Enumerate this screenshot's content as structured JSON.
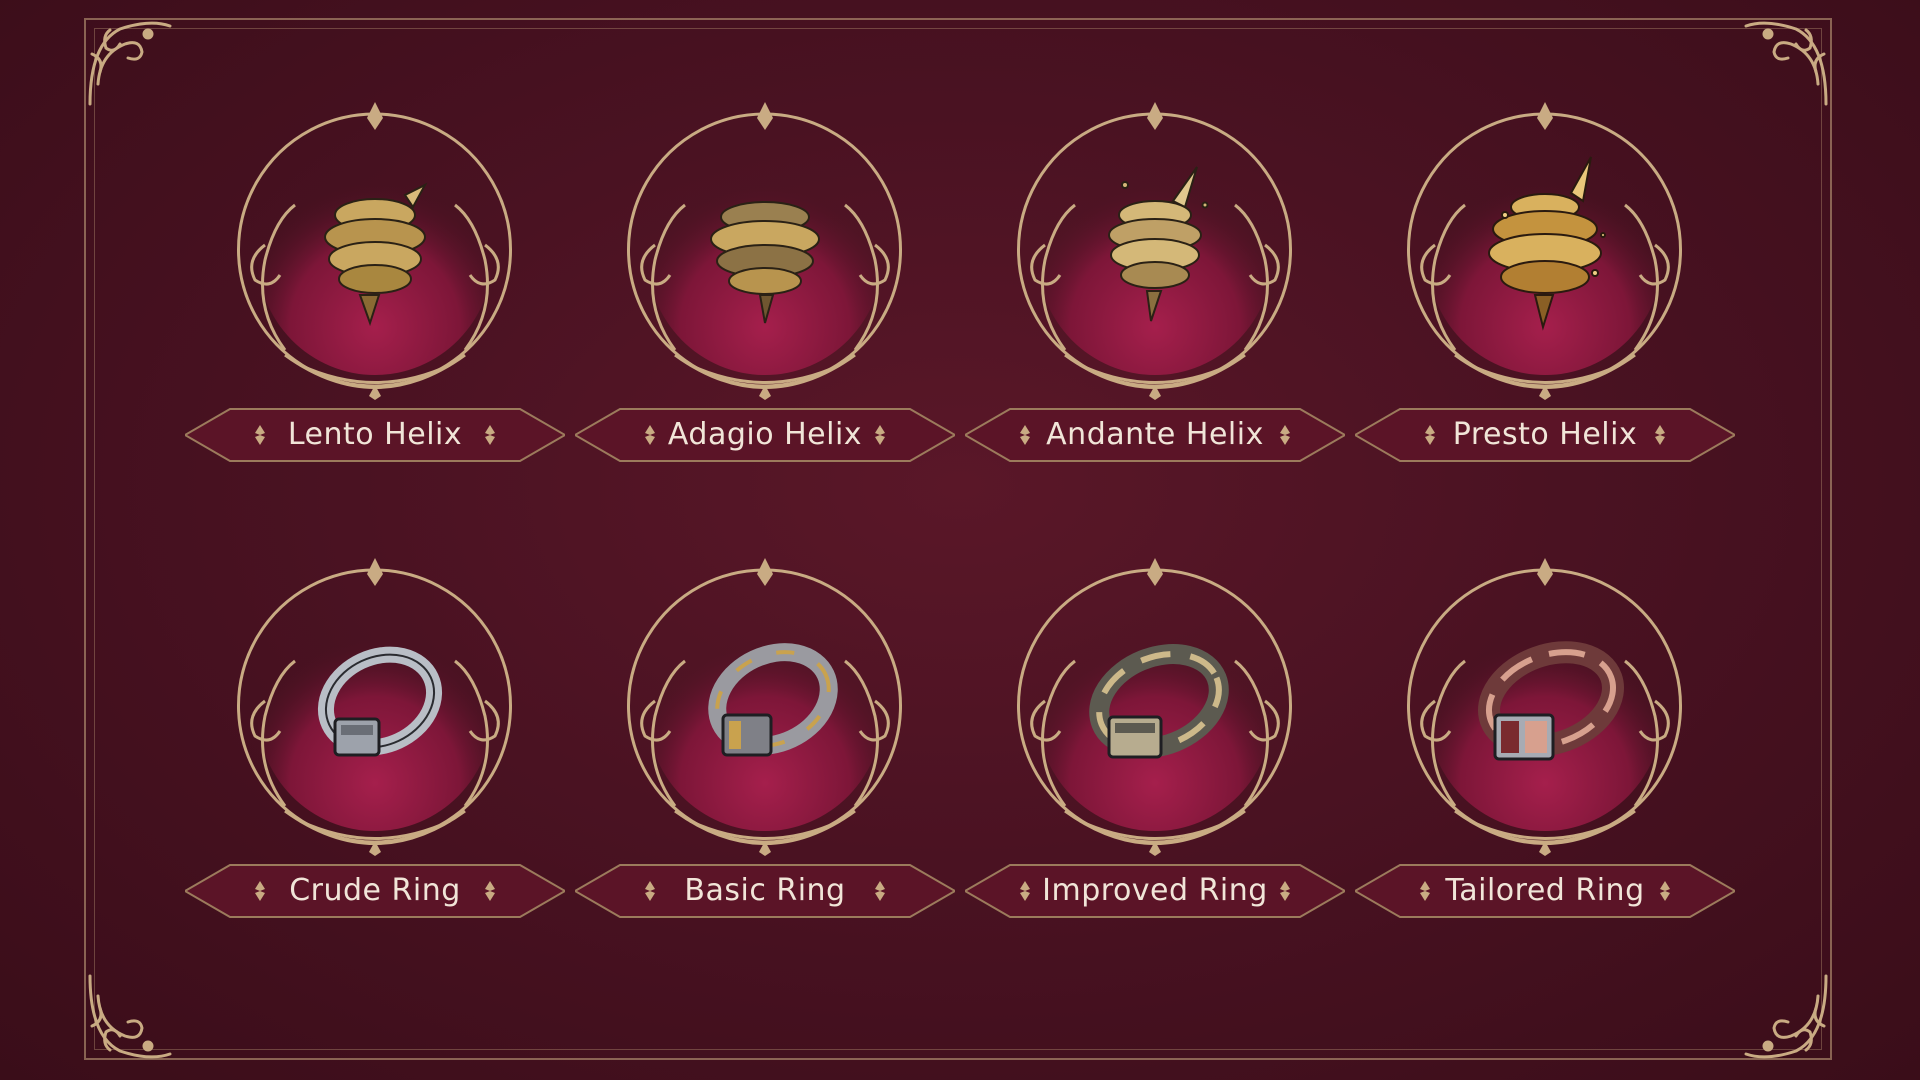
{
  "palette": {
    "background": "#4a1222",
    "gold": "#c9ab83",
    "plate": "#5b1427",
    "medallion_fill": "#8f1a41",
    "label_text": "#f1e5d8"
  },
  "helix_row": [
    {
      "name": "Lento Helix",
      "icon": "helix-icon"
    },
    {
      "name": "Adagio Helix",
      "icon": "helix-icon"
    },
    {
      "name": "Andante Helix",
      "icon": "helix-icon"
    },
    {
      "name": "Presto Helix",
      "icon": "helix-icon"
    }
  ],
  "ring_row": [
    {
      "name": "Crude Ring",
      "icon": "ring-icon"
    },
    {
      "name": "Basic Ring",
      "icon": "ring-icon"
    },
    {
      "name": "Improved Ring",
      "icon": "ring-icon"
    },
    {
      "name": "Tailored Ring",
      "icon": "ring-icon"
    }
  ]
}
